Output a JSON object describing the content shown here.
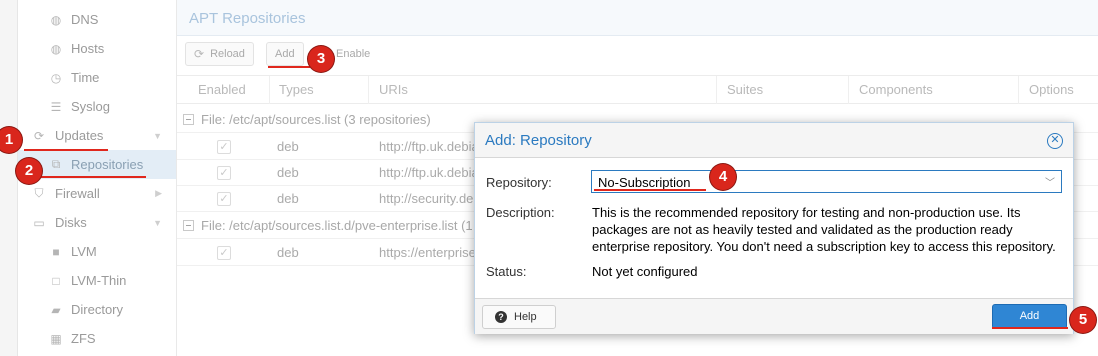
{
  "sidebar": {
    "items": [
      {
        "label": "DNS",
        "icon": "globe-icon"
      },
      {
        "label": "Hosts",
        "icon": "globe-icon"
      },
      {
        "label": "Time",
        "icon": "clock-icon"
      },
      {
        "label": "Syslog",
        "icon": "list-icon"
      },
      {
        "label": "Updates",
        "icon": "refresh-icon"
      },
      {
        "label": "Repositories",
        "icon": "repository-icon"
      },
      {
        "label": "Firewall",
        "icon": "shield-icon"
      },
      {
        "label": "Disks",
        "icon": "hdd-icon"
      },
      {
        "label": "LVM",
        "icon": "square-icon"
      },
      {
        "label": "LVM-Thin",
        "icon": "square-outline-icon"
      },
      {
        "label": "Directory",
        "icon": "folder-icon"
      },
      {
        "label": "ZFS",
        "icon": "grid-icon"
      }
    ]
  },
  "panel": {
    "title": "APT Repositories",
    "toolbar": {
      "reload": "Reload",
      "add": "Add",
      "enable": "Enable"
    },
    "columns": [
      "Enabled",
      "Types",
      "URIs",
      "Suites",
      "Components",
      "Options"
    ],
    "groups": [
      {
        "title": "File: /etc/apt/sources.list (3 repositories)",
        "rows": [
          {
            "type": "deb",
            "uri": "http://ftp.uk.debia"
          },
          {
            "type": "deb",
            "uri": "http://ftp.uk.debia"
          },
          {
            "type": "deb",
            "uri": "http://security.deb"
          }
        ]
      },
      {
        "title": "File: /etc/apt/sources.list.d/pve-enterprise.list (1",
        "rows": [
          {
            "type": "deb",
            "uri": "https://enterprise"
          }
        ]
      }
    ]
  },
  "dialog": {
    "title": "Add: Repository",
    "repository_label": "Repository:",
    "repository_value": "No-Subscription",
    "description_label": "Description:",
    "description_lines": [
      "This is the recommended repository for testing and non-production use. Its",
      "packages are not as heavily tested and validated as the production ready",
      "enterprise repository. You don't need a subscription key to access this repository."
    ],
    "status_label": "Status:",
    "status_value": "Not yet configured",
    "help_label": "Help",
    "add_label": "Add"
  },
  "annotations": {
    "markers": [
      "1",
      "2",
      "3",
      "4",
      "5"
    ],
    "color": "#d9261c"
  }
}
